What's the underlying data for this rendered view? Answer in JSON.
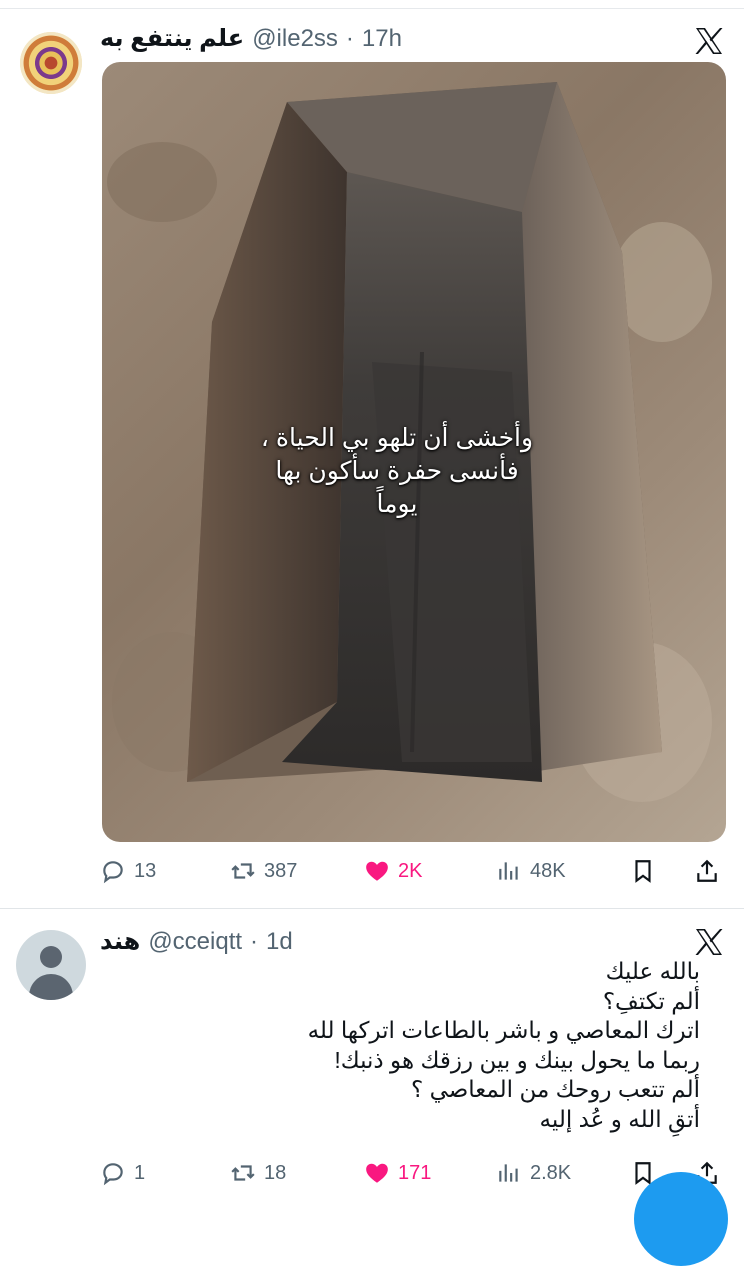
{
  "tweet": {
    "display_name": "علم ينتفع به",
    "handle": "@ile2ss",
    "separator": "·",
    "time": "17h",
    "image_caption": "وأخشى أن تلهو بي الحياة ، فأنسى حفرة سأكون بها يوماً",
    "stats": {
      "replies": "13",
      "retweets": "387",
      "likes": "2K",
      "views": "48K"
    }
  },
  "reply": {
    "display_name": "هند",
    "handle": "@cceiqtt",
    "separator": "·",
    "time": "1d",
    "lines": [
      "بالله عليك",
      "ألم تكتفِ؟",
      "اترك المعاصي و باشر بالطاعات اتركها لله",
      "ربما ما يحول بينك و بين رزقك هو ذنبك!",
      "ألم تتعب روحك من المعاصي ؟",
      "أتقِ الله و عُد إليه"
    ],
    "stats": {
      "replies": "1",
      "retweets": "18",
      "likes": "171",
      "views": "2.8K"
    }
  },
  "icons": {
    "reply": "reply-bubble-icon",
    "retweet": "retweet-icon",
    "like": "heart-icon",
    "views": "views-bar-chart-icon",
    "bookmark": "bookmark-icon",
    "share": "share-icon",
    "platform": "x-logo-icon"
  },
  "colors": {
    "like": "#f91880",
    "muted": "#536471",
    "accent": "#1d9bf0"
  }
}
